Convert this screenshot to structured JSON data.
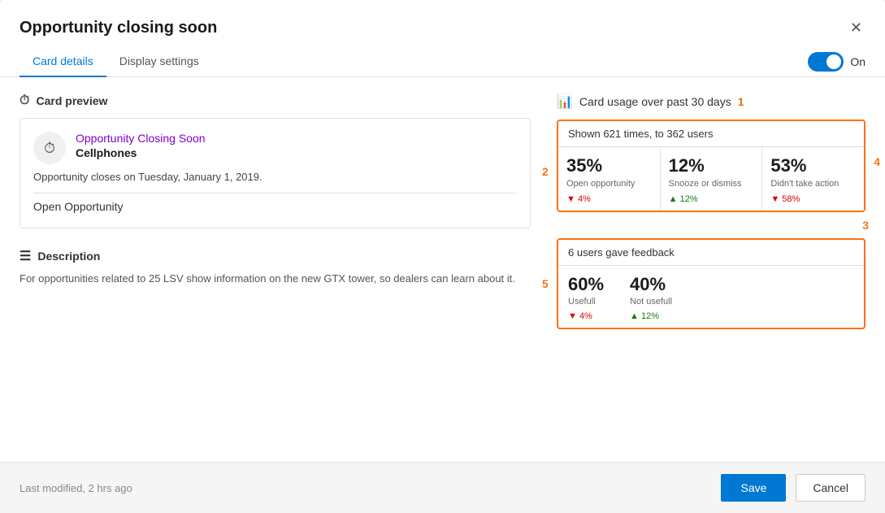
{
  "dialog": {
    "title": "Opportunity closing soon",
    "close_label": "✕"
  },
  "tabs": {
    "items": [
      {
        "label": "Card details",
        "active": true
      },
      {
        "label": "Display settings",
        "active": false
      }
    ],
    "toggle_label": "On",
    "toggle_on": true
  },
  "card_preview": {
    "section_title": "Card preview",
    "card_title": "Opportunity Closing Soon",
    "card_subtitle": "Cellphones",
    "card_body": "Opportunity closes on Tuesday, January 1, 2019.",
    "card_action": "Open Opportunity"
  },
  "description": {
    "section_title": "Description",
    "text": "For opportunities related to 25 LSV show information on the new GTX tower, so dealers can learn about it."
  },
  "usage": {
    "section_title": "Card usage over past 30 days",
    "number_label": "1",
    "shown_text": "Shown 621 times, to 362 users",
    "stats": [
      {
        "pct": "35%",
        "label": "Open opportunity",
        "change": "▼ 4%",
        "change_dir": "down"
      },
      {
        "pct": "12%",
        "label": "Snooze or dismiss",
        "change": "▲ 12%",
        "change_dir": "up"
      },
      {
        "pct": "53%",
        "label": "Didn't take action",
        "change": "▼ 58%",
        "change_dir": "down"
      }
    ],
    "label_2": "2",
    "label_3": "3",
    "label_4": "4",
    "feedback": {
      "header": "6 users gave feedback",
      "items": [
        {
          "pct": "60%",
          "label": "Usefull",
          "change": "▼ 4%",
          "change_dir": "down"
        },
        {
          "pct": "40%",
          "label": "Not usefull",
          "change": "▲ 12%",
          "change_dir": "up"
        }
      ],
      "label_5": "5"
    }
  },
  "footer": {
    "modified_text": "Last modified, 2 hrs ago",
    "save_label": "Save",
    "cancel_label": "Cancel"
  }
}
